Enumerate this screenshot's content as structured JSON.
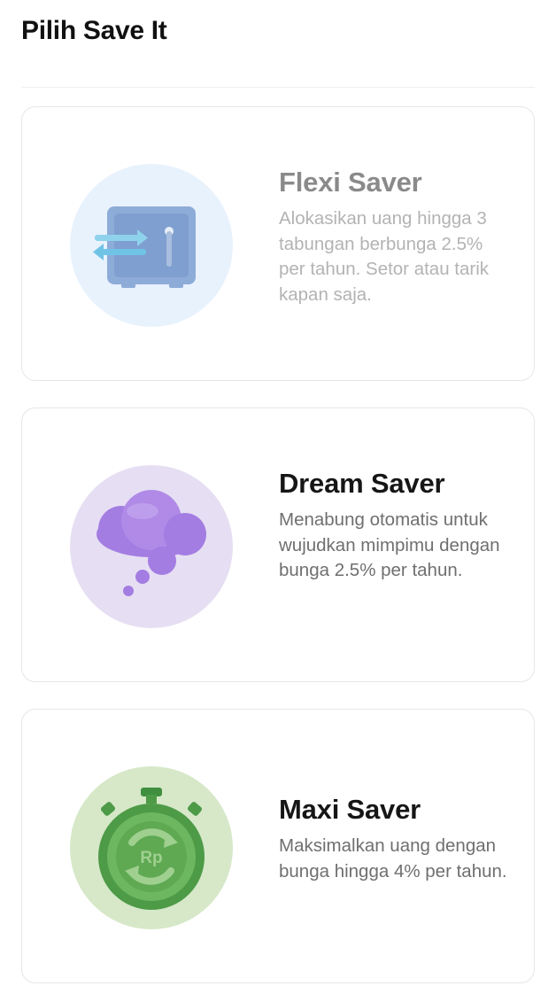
{
  "header": {
    "title": "Pilih Save It"
  },
  "options": [
    {
      "title": "Flexi Saver",
      "description": "Alokasikan uang hingga 3 tabungan berbunga 2.5% per tahun. Setor atau tarik kapan saja.",
      "icon": "safe-icon",
      "accent": "#e8f2fd",
      "state": "disabled"
    },
    {
      "title": "Dream Saver",
      "description": "Menabung otomatis untuk wujudkan mimpimu dengan bunga 2.5% per tahun.",
      "icon": "dream-cloud-icon",
      "accent": "#e6dff3"
    },
    {
      "title": "Maxi Saver",
      "description": "Maksimalkan uang dengan bunga hingga 4% per tahun.",
      "icon": "stopwatch-rupiah-icon",
      "icon_text": "Rp",
      "accent": "#d6e8c8"
    }
  ]
}
